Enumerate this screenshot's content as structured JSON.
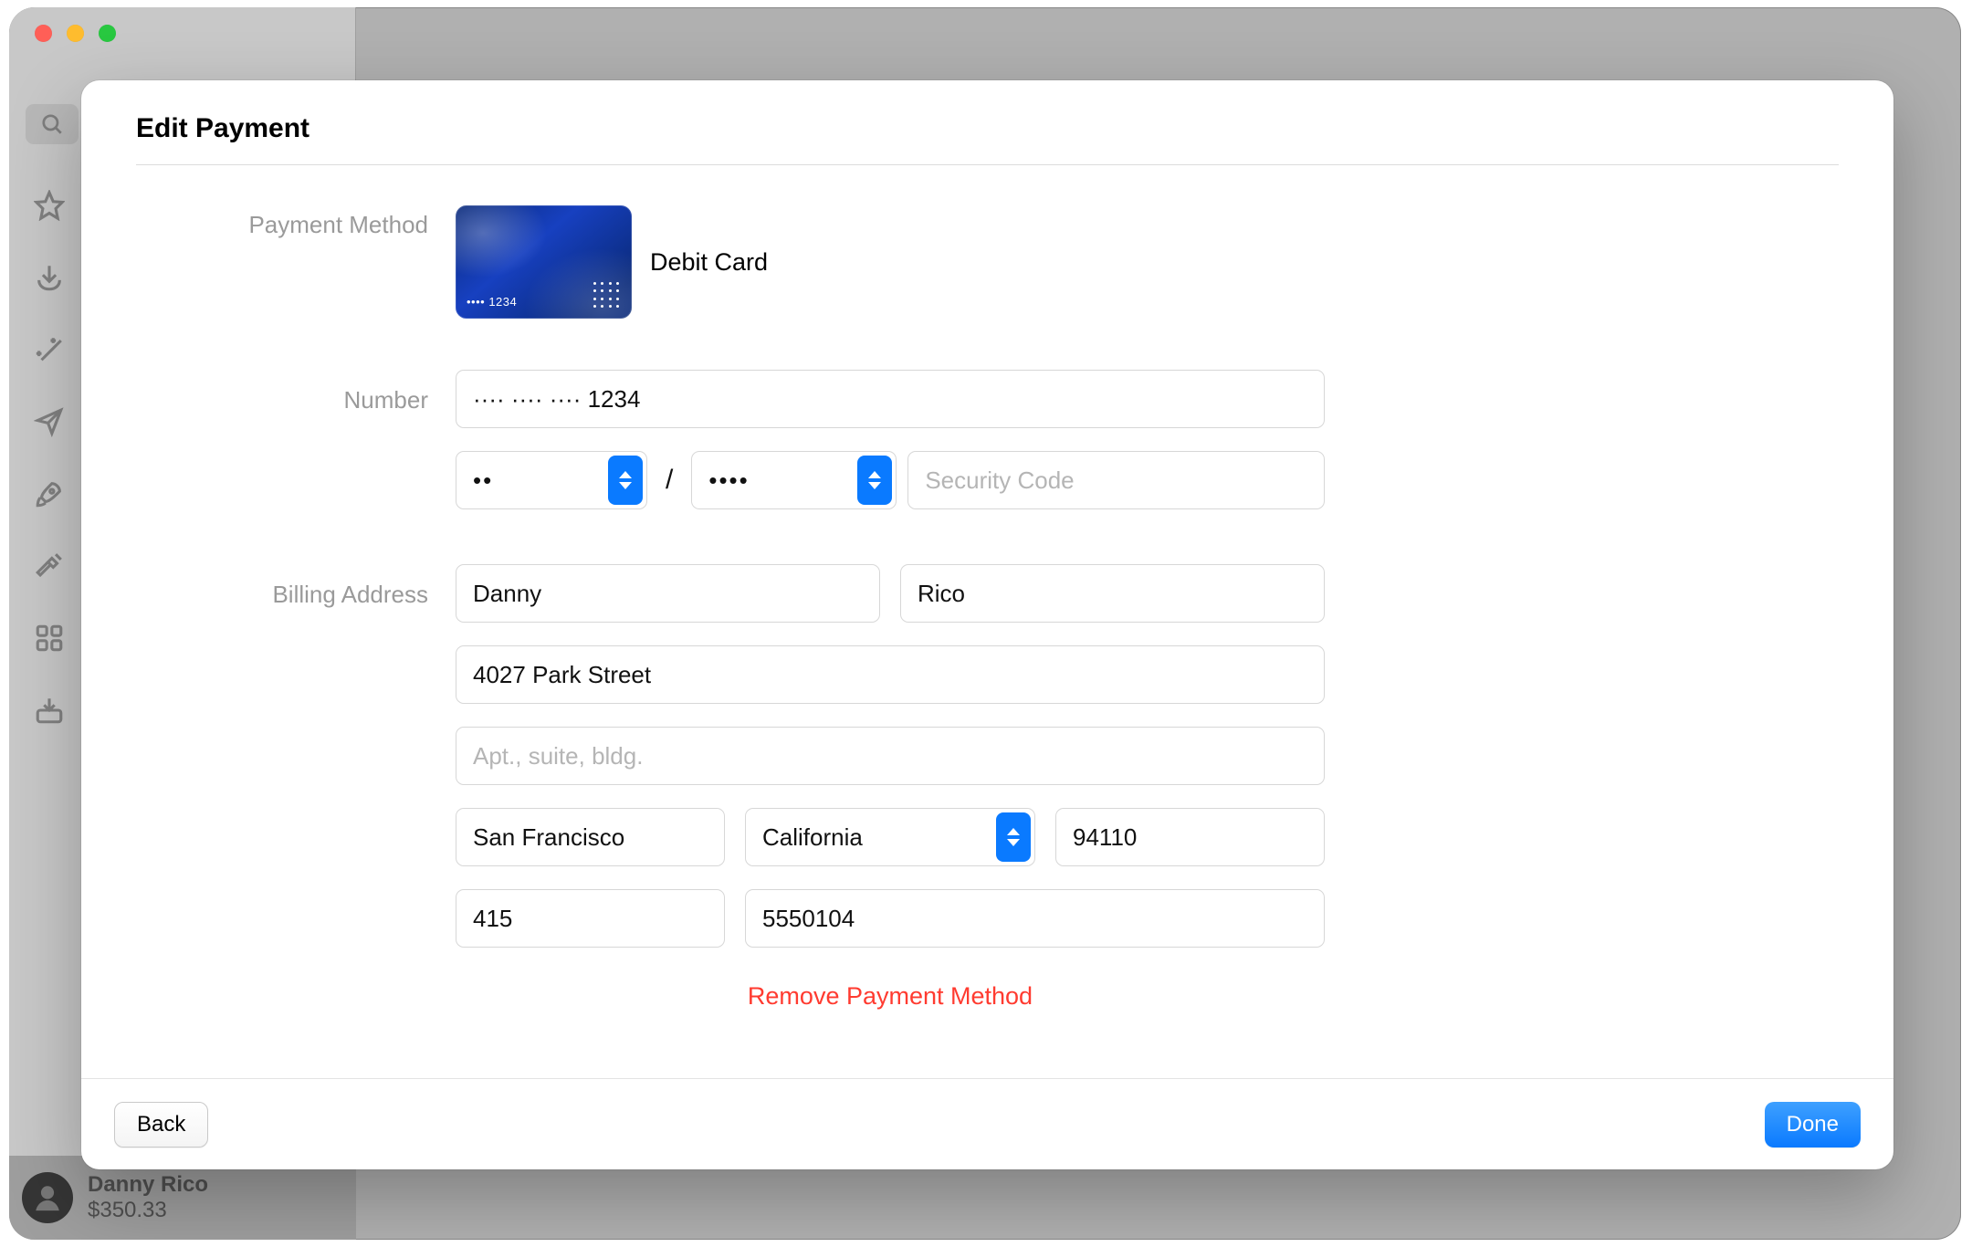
{
  "window": {
    "traffic_lights": {
      "close": "close-window",
      "minimize": "minimize-window",
      "zoom": "zoom-window"
    }
  },
  "sidebar_bg": {
    "icons": [
      "star-icon",
      "download-icon",
      "wand-icon",
      "paperplane-icon",
      "rocket-icon",
      "hammer-icon",
      "grid-icon",
      "tray-down-icon"
    ]
  },
  "account": {
    "name": "Danny Rico",
    "credit": "$350.33"
  },
  "dialog": {
    "title": "Edit Payment",
    "labels": {
      "payment_method": "Payment Method",
      "number": "Number",
      "billing_address": "Billing Address"
    },
    "card": {
      "type": "Debit Card",
      "art_mask": "•••• 1234"
    },
    "fields": {
      "card_number": "···· ···· ···· 1234",
      "exp_month": "••",
      "exp_year": "••••",
      "exp_separator": "/",
      "security_code": "",
      "security_code_placeholder": "Security Code",
      "first_name": "Danny",
      "last_name": "Rico",
      "street": "4027 Park Street",
      "street2": "",
      "street2_placeholder": "Apt., suite, bldg.",
      "city": "San Francisco",
      "state": "California",
      "zip": "94110",
      "area_code": "415",
      "phone": "5550104"
    },
    "remove_label": "Remove Payment Method",
    "buttons": {
      "back": "Back",
      "done": "Done"
    }
  }
}
